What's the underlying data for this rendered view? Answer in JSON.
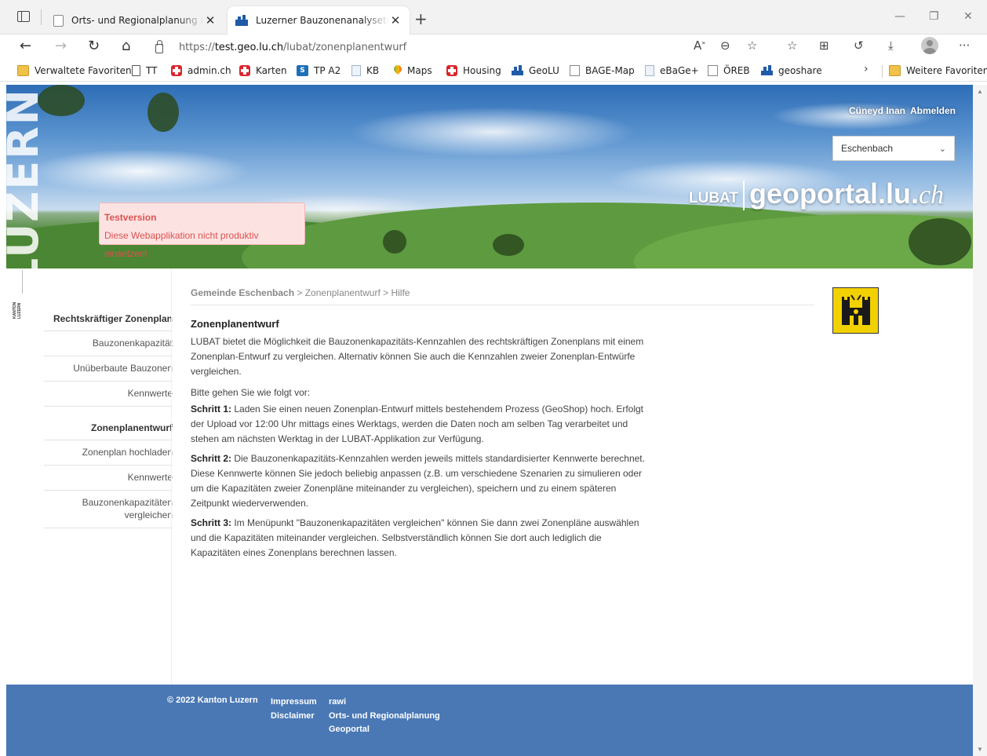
{
  "browser": {
    "tabs": [
      {
        "title": "Orts- und Regionalplanung (TEST)",
        "active": false
      },
      {
        "title": "Luzerner Bauzonenanalysetool (LUBAT)",
        "active": true
      }
    ],
    "url_prefix": "https://",
    "url_host": "test.geo.lu.ch",
    "url_path": "/lubat/zonenplanentwurf",
    "favorites": [
      {
        "label": "Verwaltete Favoriten",
        "icon": "folder-icon"
      },
      {
        "label": "TT",
        "icon": "page-icon"
      },
      {
        "label": "admin.ch",
        "icon": "swiss-cross-icon"
      },
      {
        "label": "Karten",
        "icon": "swiss-cross-icon"
      },
      {
        "label": "TP A2",
        "icon": "sp-icon"
      },
      {
        "label": "KB",
        "icon": "doc-icon"
      },
      {
        "label": "Maps",
        "icon": "map-pin-icon"
      },
      {
        "label": "Housing",
        "icon": "swiss-cross-icon"
      },
      {
        "label": "GeoLU",
        "icon": "lu-icon"
      },
      {
        "label": "BAGE-Map",
        "icon": "square-icon"
      },
      {
        "label": "eBaGe+",
        "icon": "doc-icon"
      },
      {
        "label": "ÖREB",
        "icon": "square-icon"
      },
      {
        "label": "geoshare",
        "icon": "lu-icon"
      }
    ],
    "other_favorites": "Weitere Favoriten"
  },
  "header": {
    "user_name": "Cüneyd Inan",
    "logout_label": "Abmelden",
    "gemeinde_selected": "Eschenbach",
    "logo_text": "LUZERN",
    "brand_lubat": "LUBAT",
    "brand_geo": "geoportal.lu.",
    "brand_ch": "ch",
    "test_title": "Testversion",
    "test_message": "Diese Webapplikation nicht produktiv einsetzen!"
  },
  "sidebar": {
    "kanton_mark": "KANTON LUZERN",
    "section1": "Rechtskräftiger Zonenplan",
    "section1_items": [
      "Bauzonenkapazität",
      "Unüberbaute Bauzonen",
      "Kennwerte"
    ],
    "section2": "Zonenplanentwurf",
    "section2_items": [
      "Zonenplan hochladen",
      "Kennwerte",
      "Bauzonenkapazitäten vergleichen"
    ]
  },
  "content": {
    "breadcrumb_gemeinde": "Gemeinde Eschenbach",
    "breadcrumb_rest": " > Zonenplanentwurf > Hilfe",
    "title": "Zonenplanentwurf",
    "intro": "LUBAT bietet die Möglichkeit die Bauzonenkapazitäts-Kennzahlen des rechtskräftigen Zonenplans mit einem Zonenplan-Entwurf zu vergleichen. Alternativ können Sie auch die Kennzahlen zweier Zonenplan-Entwürfe vergleichen.",
    "steps_intro": "Bitte gehen Sie wie folgt vor:",
    "step1_label": "Schritt 1:",
    "step1_text": " Laden Sie einen neuen Zonenplan-Entwurf mittels bestehendem Prozess (GeoShop) hoch. Erfolgt der Upload vor 12:00 Uhr mittags eines Werktags, werden die Daten noch am selben Tag verarbeitet und stehen am nächsten Werktag in der LUBAT-Applikation zur Verfügung.",
    "step2_label": "Schritt 2:",
    "step2_text": " Die Bauzonenkapazitäts-Kennzahlen werden jeweils mittels standardisierter Kennwerte berechnet. Diese Kennwerte können Sie jedoch beliebig anpassen (z.B. um verschiedene Szenarien zu simulieren oder um die Kapazitäten zweier Zonenpläne miteinander zu vergleichen), speichern und zu einem späteren Zeitpunkt wiederverwenden.",
    "step3_label": "Schritt 3:",
    "step3_text": " Im Menüpunkt \"Bauzonenkapazitäten vergleichen\" können Sie dann zwei Zonenpläne auswählen und die Kapazitäten miteinander vergleichen. Selbstverständlich können Sie dort auch lediglich die Kapazitäten eines Zonenplans berechnen lassen."
  },
  "footer": {
    "copyright": "© 2022 Kanton Luzern",
    "col1": [
      "Impressum",
      "Disclaimer"
    ],
    "col2": [
      "rawi",
      "Orts- und Regionalplanung",
      "Geoportal"
    ]
  },
  "colors": {
    "footer_bg": "#4a78b5",
    "test_bg": "#fde2e2",
    "test_text": "#d9534f",
    "wappen_yellow": "#f2d100"
  }
}
